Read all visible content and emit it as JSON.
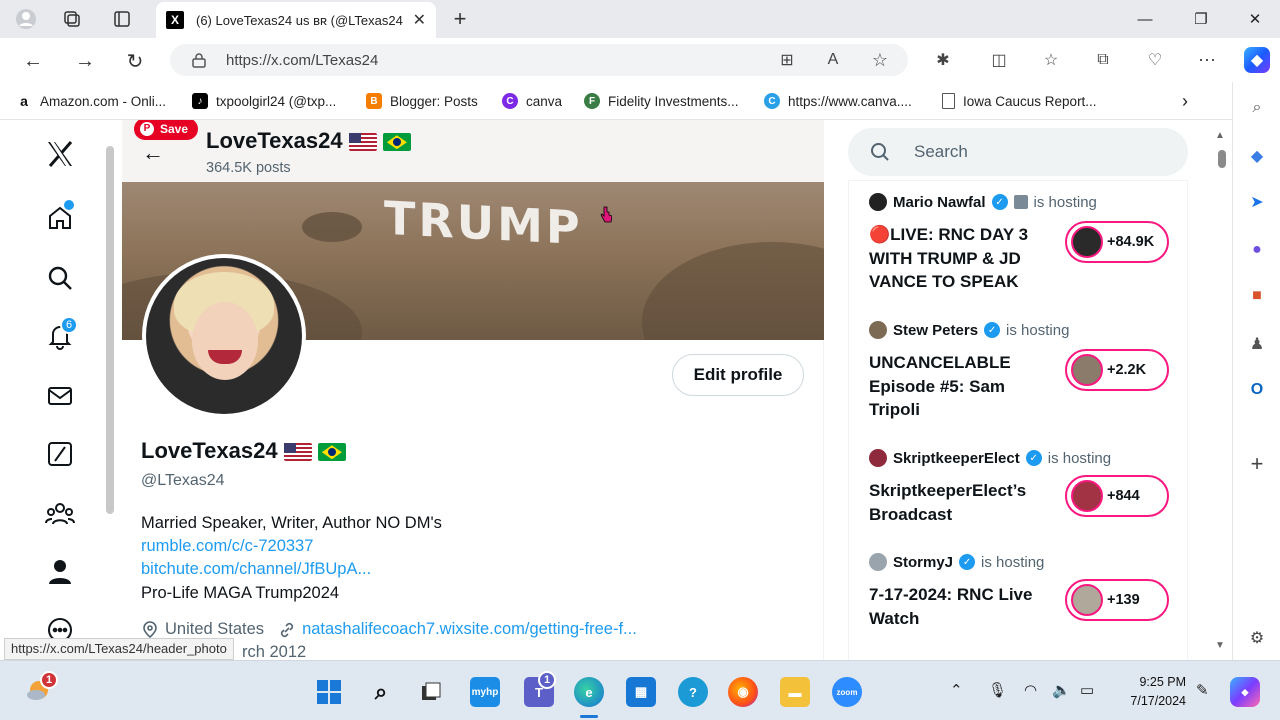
{
  "browser": {
    "tab_title": "(6) LoveTexas24 us ʙʀ (@LTexas24",
    "url": "https://x.com/LTexas24",
    "bookmarks": [
      {
        "label": "Amazon.com - Onli...",
        "icon": "amazon-icon",
        "color": "#111111"
      },
      {
        "label": "txpoolgirl24 (@txp...",
        "icon": "tiktok-icon",
        "color": "#000000"
      },
      {
        "label": "Blogger: Posts",
        "icon": "blogger-icon",
        "color": "#f57d00"
      },
      {
        "label": "canva",
        "icon": "canva-icon",
        "color": "#7d2ae8"
      },
      {
        "label": "Fidelity Investments...",
        "icon": "fidelity-icon",
        "color": "#3a7d44"
      },
      {
        "label": "https://www.canva....",
        "icon": "canva-icon",
        "color": "#2aa0e8"
      },
      {
        "label": "Iowa Caucus Report...",
        "icon": "document-icon",
        "color": "#ffffff"
      }
    ]
  },
  "profile": {
    "header_name": "LoveTexas24",
    "header_posts": "364.5K posts",
    "pinterest_save": "Save",
    "banner_text": "TRUMP",
    "name": "LoveTexas24",
    "handle": "@LTexas24",
    "edit_label": "Edit profile",
    "bio_line1": "Married Speaker,  Writer,  Author  NO DM's",
    "bio_link1": "rumble.com/c/c-720337",
    "bio_link2": "bitchute.com/channel/JfBUpA...",
    "bio_line2": "Pro-Life MAGA  Trump2024",
    "location": "United States",
    "website": "natashalifecoach7.wixsite.com/getting-free-f...",
    "joined": "rch 2012"
  },
  "nav": {
    "notifications_badge": "6"
  },
  "status_bar_url": "https://x.com/LTexas24/header_photo",
  "search": {
    "placeholder": "Search"
  },
  "spaces": [
    {
      "host": "Mario Nawfal",
      "hosting": "is hosting",
      "title": "🔴LIVE: RNC DAY 3 WITH TRUMP & JD VANCE TO SPEAK",
      "count": "+84.9K"
    },
    {
      "host": "Stew Peters",
      "hosting": "is hosting",
      "title": "UNCANCELABLE Episode #5: Sam Tripoli",
      "count": "+2.2K"
    },
    {
      "host": "SkriptkeeperElect",
      "hosting": "is hosting",
      "title": "SkriptkeeperElect’s Broadcast",
      "count": "+844"
    },
    {
      "host": "StormyJ",
      "hosting": "is hosting",
      "title": "7-17-2024: RNC Live Watch",
      "count": "+139"
    }
  ],
  "taskbar": {
    "weather_badge": "1",
    "teams_badge": "1",
    "time": "9:25 PM",
    "date": "7/17/2024",
    "myhp_label": "myhp",
    "zoom_label": "zoom"
  },
  "colors": {
    "x_blue": "#1d9bf0",
    "spaces_pink": "#f91880",
    "pinterest_red": "#e60023"
  }
}
